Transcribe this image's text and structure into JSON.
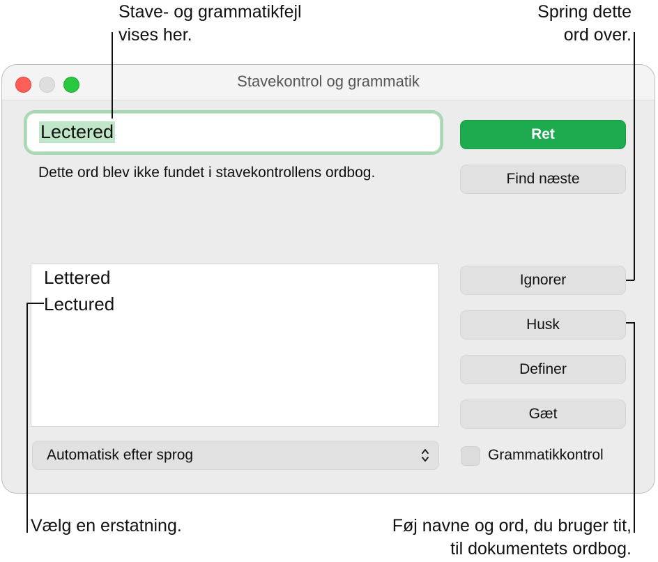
{
  "callouts": {
    "spelling_errors": [
      "Stave- og grammatikfejl",
      "vises her."
    ],
    "skip_word": [
      "Spring dette",
      "ord over."
    ],
    "choose_replacement": "Vælg en erstatning.",
    "add_words": [
      "Føj navne og ord, du bruger tit,",
      "til dokumentets ordbog."
    ]
  },
  "window": {
    "title": "Stavekontrol og grammatik",
    "misspelled_word": "Lectered",
    "status_message": "Dette ord blev ikke fundet i stavekontrollens ordbog.",
    "buttons": {
      "correct": "Ret",
      "find_next": "Find næste",
      "ignore": "Ignorer",
      "learn": "Husk",
      "define": "Definer",
      "guess": "Gæt"
    },
    "suggestions": [
      "Lettered",
      "Lectured"
    ],
    "language_popup": "Automatisk efter sprog",
    "grammar_checkbox": {
      "label": "Grammatikkontrol",
      "checked": false
    }
  },
  "colors": {
    "primary_button": "#1eaa4f",
    "focus_ring": "#a8d8b3",
    "close": "#ff5f57",
    "maximize": "#28c840"
  }
}
